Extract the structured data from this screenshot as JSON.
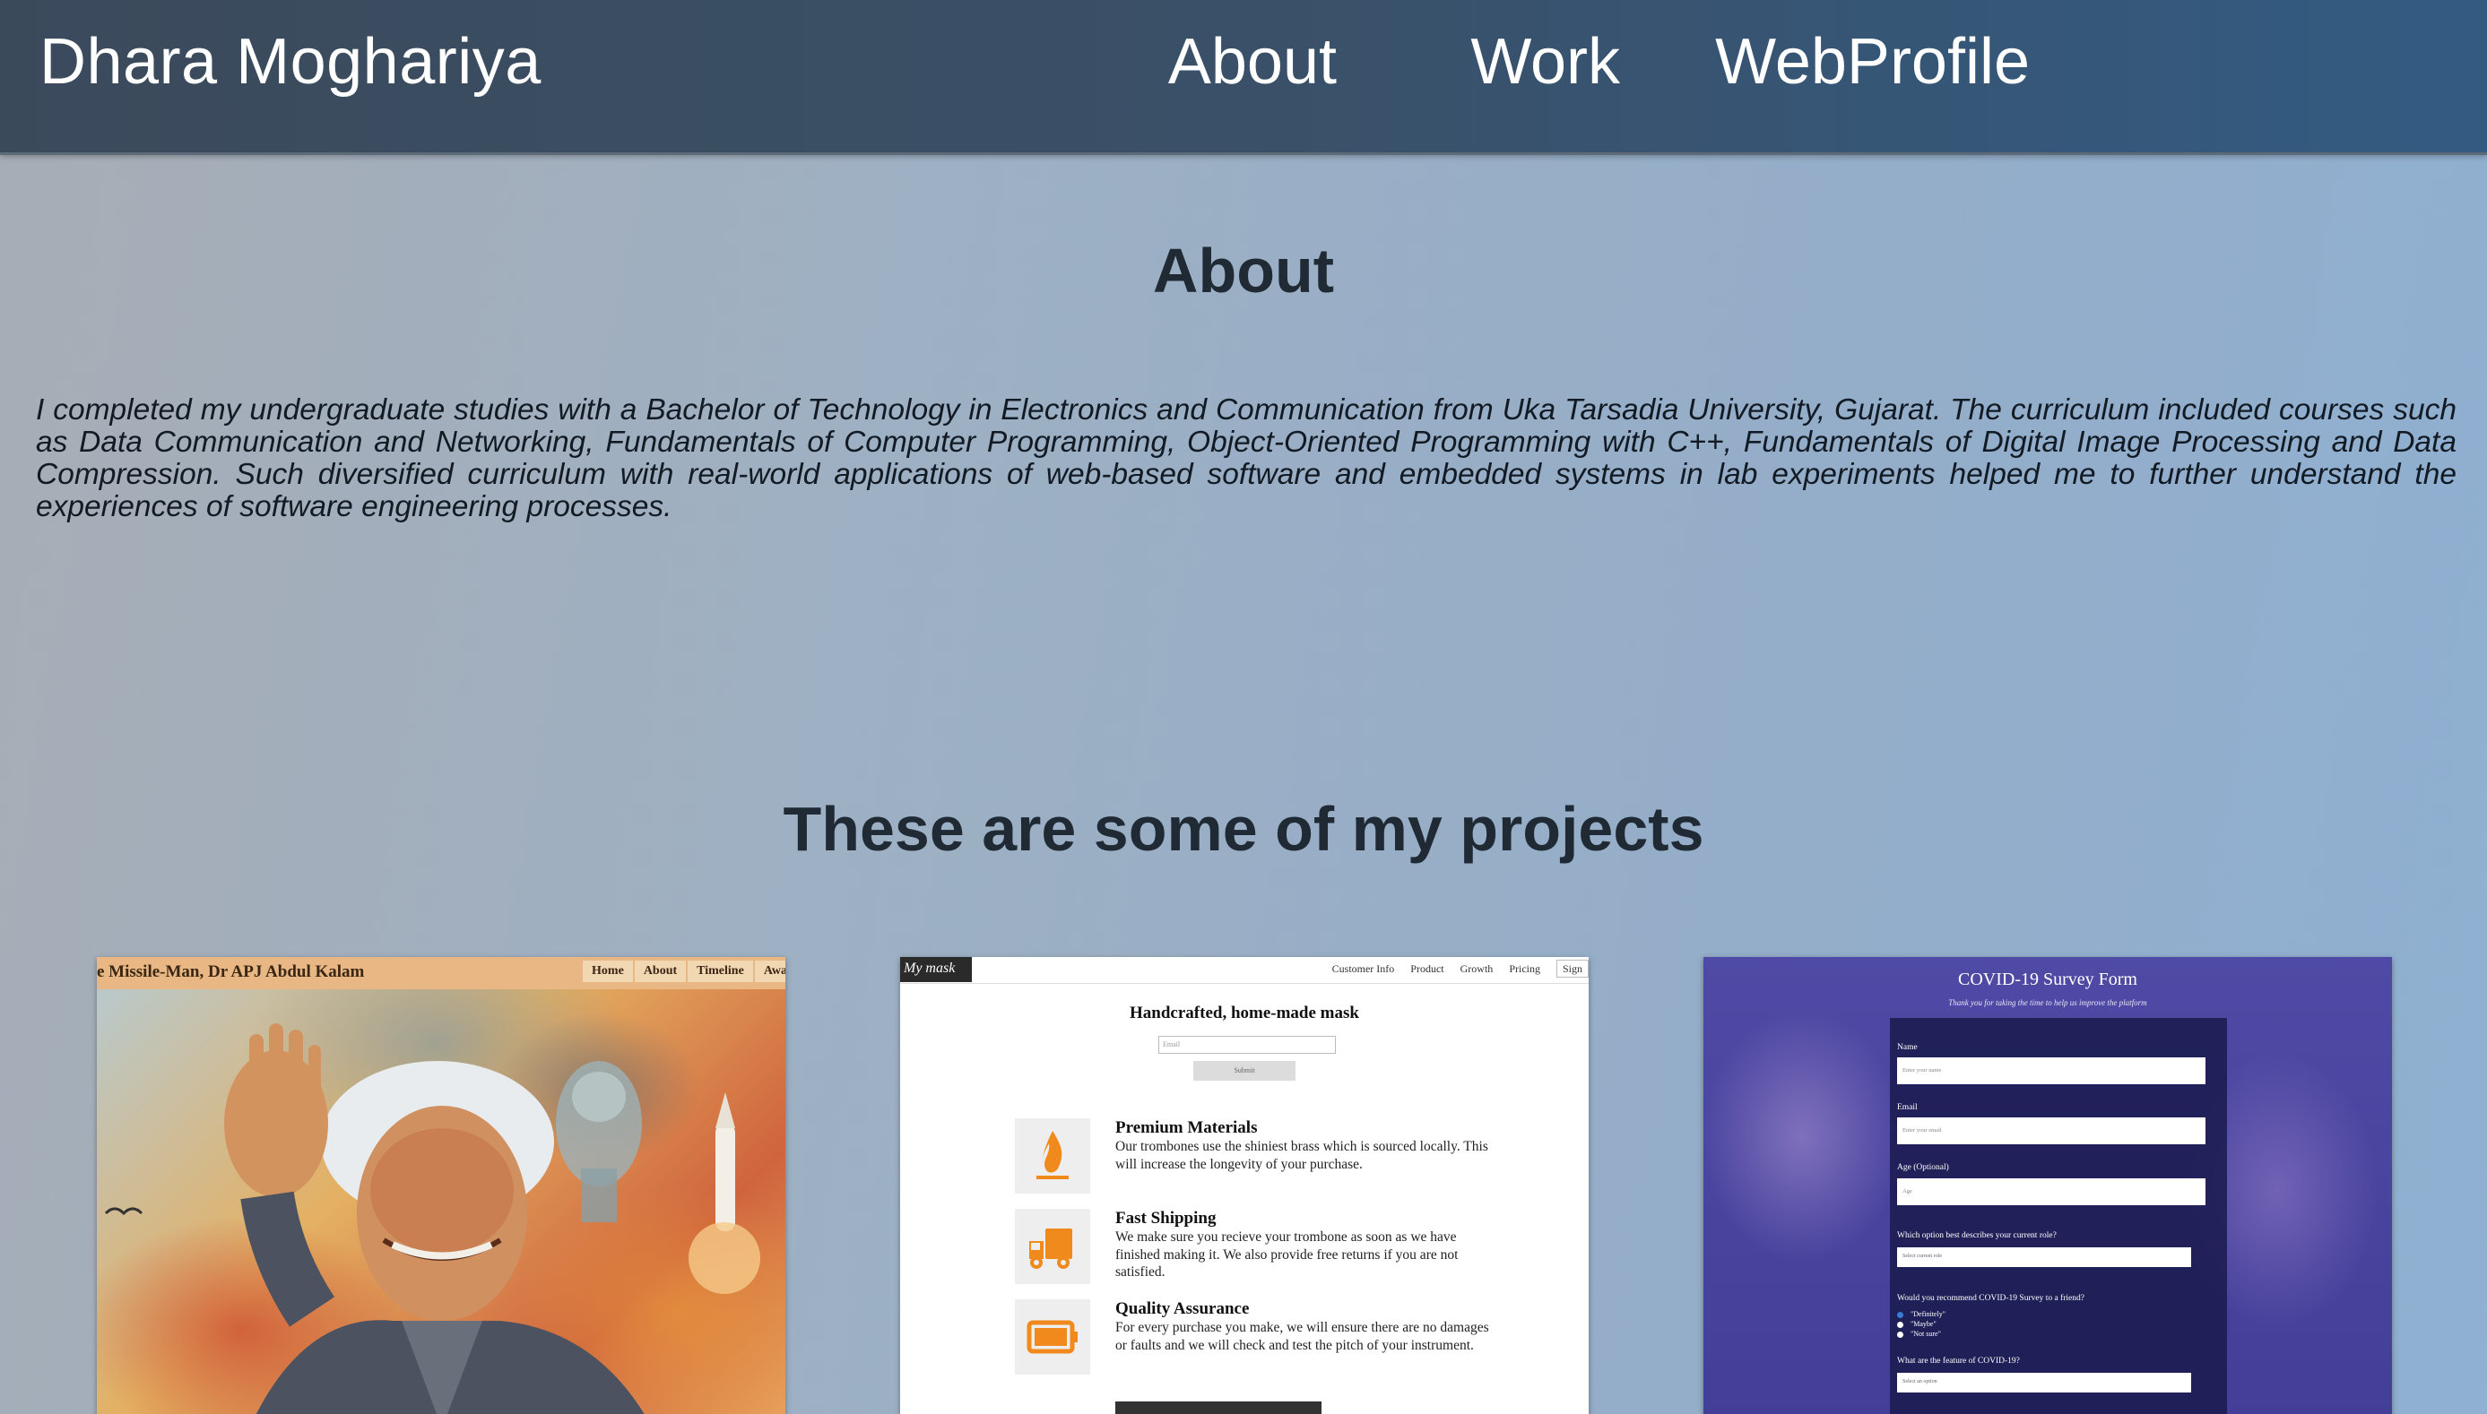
{
  "header": {
    "brand": "Dhara Moghariya",
    "nav": [
      {
        "label": "About"
      },
      {
        "label": "Work"
      },
      {
        "label": "WebProfile"
      }
    ]
  },
  "about": {
    "title": "About",
    "text": "I completed my undergraduate studies with a Bachelor of Technology in Electronics and Communication from Uka Tarsadia University, Gujarat. The curriculum included courses such as Data Communication and Networking, Fundamentals of Computer Programming, Object-Oriented Programming with C++, Fundamentals of Digital Image Processing and Data Compression. Such diversified curriculum with real-world applications of web-based software and embedded systems in lab experiments helped me to further understand the experiences of software engineering processes."
  },
  "projects": {
    "title": "These are some of my projects",
    "cards": [
      {
        "title": "e Missile-Man, Dr APJ Abdul Kalam",
        "nav": [
          "Home",
          "About",
          "Timeline",
          "Awa"
        ]
      },
      {
        "logo": "My mask",
        "nav": [
          "Customer Info",
          "Product",
          "Growth",
          "Pricing",
          "Sign"
        ],
        "hero": "Handcrafted, home-made mask",
        "email_placeholder": "Email",
        "submit": "Submit",
        "features": [
          {
            "title": "Premium Materials",
            "body": "Our trombones use the shiniest brass which is sourced locally. This will increase the longevity of your purchase.",
            "icon": "flame-icon"
          },
          {
            "title": "Fast Shipping",
            "body": "We make sure you recieve your trombone as soon as we have finished making it. We also provide free returns if you are not satisfied.",
            "icon": "truck-icon"
          },
          {
            "title": "Quality Assurance",
            "body": "For every purchase you make, we will ensure there are no damages or faults and we will check and test the pitch of your instrument.",
            "icon": "battery-icon"
          }
        ]
      },
      {
        "title": "COVID-19 Survey Form",
        "subtitle": "Thank you for taking the time to help us improve the platform",
        "name_label": "Name",
        "name_placeholder": "Enter your name",
        "email_label": "Email",
        "email_placeholder": "Enter your email",
        "age_label": "Age (Optional)",
        "age_placeholder": "Age",
        "role_label": "Which option best describes your current role?",
        "role_selected": "Select current role",
        "recommend_label": "Would you recommend COVID-19 Survey to a friend?",
        "options": [
          "\"Definitely\"",
          "\"Maybe\"",
          "\"Not sure\""
        ],
        "feature_label": "What are the feature of COVID-19?",
        "feature_selected": "Select an option"
      }
    ]
  },
  "colors": {
    "accent_orange": "#f08a1c",
    "header_dark": "#3b4a5b",
    "survey_bg": "#4f4aa5"
  }
}
